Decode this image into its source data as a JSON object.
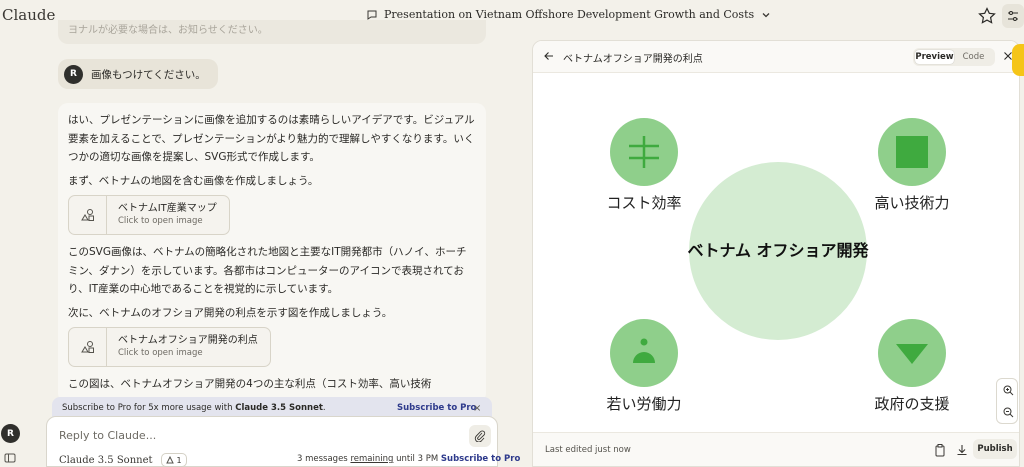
{
  "app": {
    "brand": "Claude"
  },
  "conversation": {
    "title": "Presentation on Vietnam Offshore Development Growth and Costs"
  },
  "chat": {
    "faded_text": "ヨナルが必要な場合は、お知らせください。",
    "user_initial": "R",
    "user_message": "画像もつけてください。",
    "assistant": {
      "p1": "はい、プレゼンテーションに画像を追加するのは素晴らしいアイデアです。ビジュアル要素を加えることで、プレゼンテーションがより魅力的で理解しやすくなります。いくつかの適切な画像を提案し、SVG形式で作成します。",
      "p2": "まず、ベトナムの地図を含む画像を作成しましょう。",
      "artifact1_title": "ベトナムIT産業マップ",
      "artifact1_sub": "Click to open image",
      "p3": "このSVG画像は、ベトナムの簡略化された地図と主要なIT開発都市（ハノイ、ホーチミン、ダナン）を示しています。各都市はコンピューターのアイコンで表現されており、IT産業の中心地であることを視覚的に示しています。",
      "p4": "次に、ベトナムのオフショア開発の利点を示す図を作成しましょう。",
      "artifact2_title": "ベトナムオフショア開発の利点",
      "artifact2_sub": "Click to open image",
      "p5": "この図は、ベトナムオフショア開発の4つの主な利点（コスト効率、高い技術"
    },
    "promo": {
      "text_prefix": "Subscribe to Pro for 5x more usage with ",
      "text_bold": "Claude 3.5 Sonnet",
      "text_suffix": ".",
      "link": "Subscribe to Pro",
      "close": "×"
    },
    "composer": {
      "placeholder": "Reply to Claude...",
      "model": "Claude 3.5 Sonnet",
      "count": "1",
      "remaining_prefix": "3 messages ",
      "remaining_underline": "remaining",
      "remaining_suffix": " until 3 PM",
      "subscribe": "Subscribe to Pro"
    },
    "sidebar_initial": "R"
  },
  "artifact_panel": {
    "title": "ベトナムオフショア開発の利点",
    "tabs": [
      "Preview",
      "Code"
    ],
    "active_tab": "Preview",
    "footer_text": "Last edited just now",
    "publish_label": "Publish",
    "diagram": {
      "center_label": "ベトナム オフショア開発",
      "items": [
        {
          "label": "コスト効率",
          "icon": "equals-cross"
        },
        {
          "label": "高い技術力",
          "icon": "square"
        },
        {
          "label": "若い労働力",
          "icon": "person"
        },
        {
          "label": "政府の支援",
          "icon": "triangle-down"
        }
      ],
      "colors": {
        "center_fill": "#d4ecd2",
        "item_fill": "#8fcf8b",
        "icon_fill": "#3faa3f"
      }
    }
  }
}
